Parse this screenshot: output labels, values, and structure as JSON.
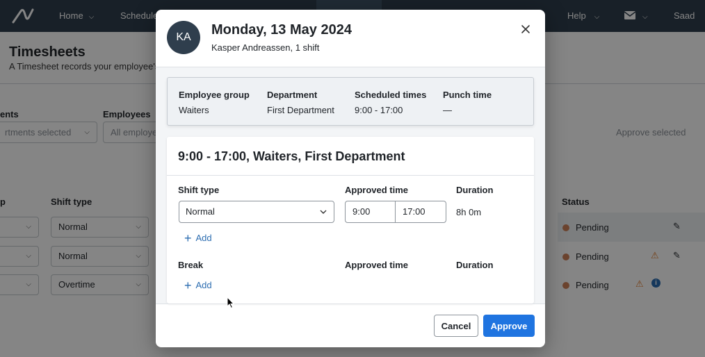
{
  "topbar": {
    "nav": [
      {
        "label": "Home"
      },
      {
        "label": "Schedule"
      },
      {
        "label": "Help"
      },
      {
        "label": "Saad"
      }
    ]
  },
  "page": {
    "title": "Timesheets",
    "subtitle": "A Timesheet records your employee's d",
    "filters": {
      "departments_label": "ents",
      "departments_value": "rtments selected",
      "employees_label": "Employees",
      "employees_value": "All employe"
    },
    "approve_selected": "Approve selected",
    "columns": {
      "group": "p",
      "shift_type": "Shift type",
      "status": "Status"
    },
    "rows": [
      {
        "shift_type": "Normal",
        "status": "Pending"
      },
      {
        "shift_type": "Normal",
        "status": "Pending"
      },
      {
        "shift_type": "Overtime",
        "status": "Pending"
      }
    ]
  },
  "modal": {
    "avatar_initials": "KA",
    "title": "Monday, 13 May 2024",
    "subtitle": "Kasper Andreassen, 1 shift",
    "summary": {
      "employee_group_label": "Employee group",
      "employee_group_value": "Waiters",
      "department_label": "Department",
      "department_value": "First Department",
      "scheduled_label": "Scheduled times",
      "scheduled_value": "9:00 - 17:00",
      "punch_label": "Punch time",
      "punch_value": "—"
    },
    "shift": {
      "title": "9:00 - 17:00, Waiters, First Department",
      "shift_type_label": "Shift type",
      "shift_type_value": "Normal",
      "approved_time_label": "Approved time",
      "start_time": "9:00",
      "end_time": "17:00",
      "duration_label": "Duration",
      "duration_value": "8h 0m",
      "add_label": "Add",
      "break_label": "Break",
      "break_approved_label": "Approved time",
      "break_duration_label": "Duration",
      "break_add_label": "Add"
    },
    "footer": {
      "cancel_label": "Cancel",
      "approve_label": "Approve"
    }
  },
  "colors": {
    "topbar": "#2f3e4d",
    "primary": "#1f74e0",
    "link": "#2b6cb0",
    "pending_dot": "#d0825b"
  }
}
